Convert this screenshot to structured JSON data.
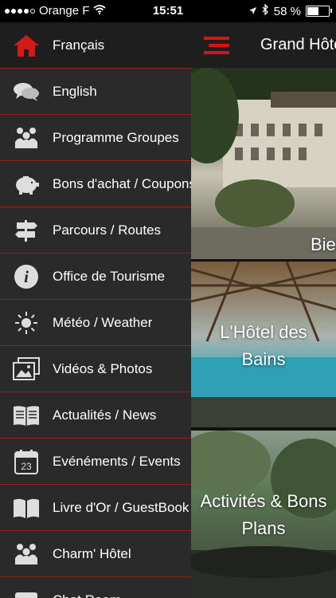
{
  "status_bar": {
    "carrier": "Orange F",
    "time": "15:51",
    "battery": "58 %",
    "battery_level": 0.58
  },
  "menu": {
    "items": [
      {
        "label": "Français",
        "icon": "house-icon",
        "selected": true
      },
      {
        "label": "English",
        "icon": "chat-bubbles-icon"
      },
      {
        "label": "Programme Groupes",
        "icon": "group-icon"
      },
      {
        "label": "Bons d'achat / Coupons",
        "icon": "piggy-bank-icon"
      },
      {
        "label": "Parcours / Routes",
        "icon": "signpost-icon"
      },
      {
        "label": "Office de Tourisme",
        "icon": "info-icon"
      },
      {
        "label": "Météo /  Weather",
        "icon": "sun-icon"
      },
      {
        "label": "Vidéos & Photos",
        "icon": "photos-icon"
      },
      {
        "label": "Actualités / News",
        "icon": "newspaper-icon"
      },
      {
        "label": "Evénéments / Events",
        "icon": "calendar-icon",
        "calendar_day": "23"
      },
      {
        "label": "Livre d'Or / GuestBook",
        "icon": "book-icon"
      },
      {
        "label": "Charm' Hôtel",
        "icon": "group-icon"
      },
      {
        "label": "Chat Room",
        "icon": "chat-icon"
      }
    ]
  },
  "content": {
    "title": "Grand Hôtel",
    "cards": [
      {
        "caption": "Bienvenue"
      },
      {
        "caption": "L'Hôtel des Bains"
      },
      {
        "caption": "Activités & Bons Plans"
      }
    ]
  },
  "colors": {
    "accent": "#d11a1a",
    "menu_bg": "#2a2a2a",
    "divider": "#9a1c1c"
  }
}
